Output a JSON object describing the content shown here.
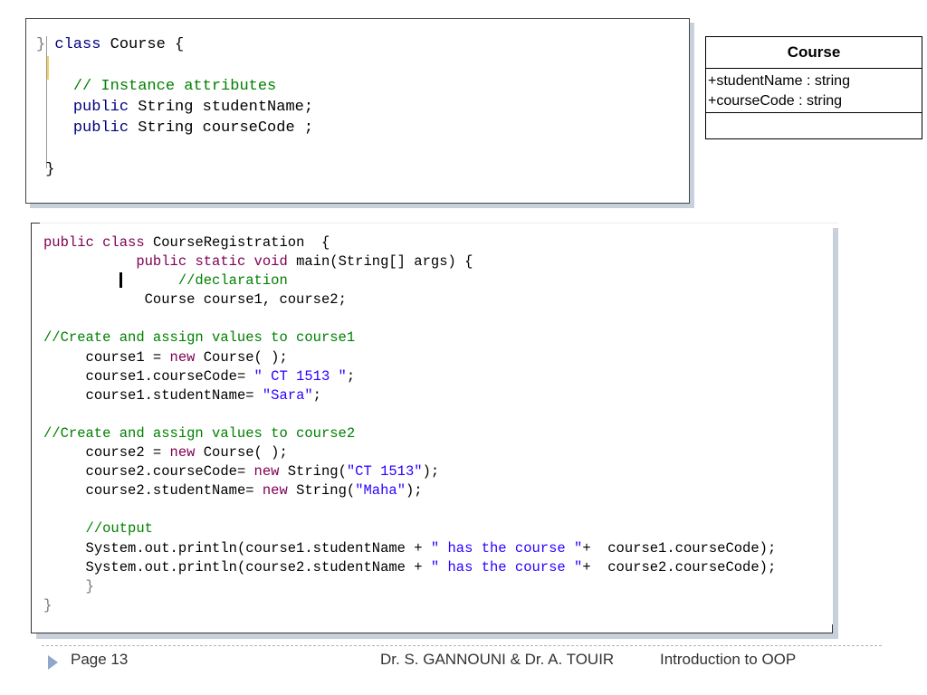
{
  "class_code": {
    "open_brace_marker": "}",
    "kw_class": "class",
    "class_name": " Course {",
    "comment": "// Instance attributes",
    "line1_kw": "public",
    "line1_rest": " String studentName;",
    "line2_kw": "public",
    "line2_rest": " String courseCode ;",
    "close": "}"
  },
  "uml": {
    "class_name": "Course",
    "attributes": [
      "+studentName : string",
      "+courseCode : string"
    ],
    "methods": []
  },
  "main_code": {
    "l1_kw1": "public",
    "l1_kw2": "class",
    "l1_rest": " CourseRegistration  {",
    "l2_kw": "public static void",
    "l2_rest": " main(String[] args) {",
    "l3_comment": "//declaration",
    "l4": " Course course1, course2;",
    "l5_comment": "//Create and assign values to course1",
    "l6_a": "course1 = ",
    "l6_kw": "new",
    "l6_b": " Course( );",
    "l7_a": "course1.courseCode= ",
    "l7_str": "\" CT 1513 \"",
    "l7_b": ";",
    "l8_a": "course1.studentName= ",
    "l8_str": "\"Sara\"",
    "l8_b": ";",
    "l9_comment": "//Create and assign values to course2",
    "l10_a": "course2 = ",
    "l10_kw": "new",
    "l10_b": " Course( );",
    "l11_a": "course2.courseCode= ",
    "l11_kw": "new",
    "l11_b": " String(",
    "l11_str": "\"CT 1513\"",
    "l11_c": ");",
    "l12_a": "course2.studentName= ",
    "l12_kw": "new",
    "l12_b": " String(",
    "l12_str": "\"Maha\"",
    "l12_c": ");",
    "l13_comment": "//output",
    "l14_a": "System.out.println(course1.studentName + ",
    "l14_str": "\" has the course \"",
    "l14_b": "+  course1.courseCode);",
    "l15_a": "System.out.println(course2.studentName + ",
    "l15_str": "\" has the course \"",
    "l15_b": "+  course2.courseCode);",
    "l16": "}",
    "l17": "}"
  },
  "footer": {
    "page": "Page 13",
    "authors": "Dr. S. GANNOUNI & Dr.  A. TOUIR",
    "course": "Introduction to OOP"
  }
}
